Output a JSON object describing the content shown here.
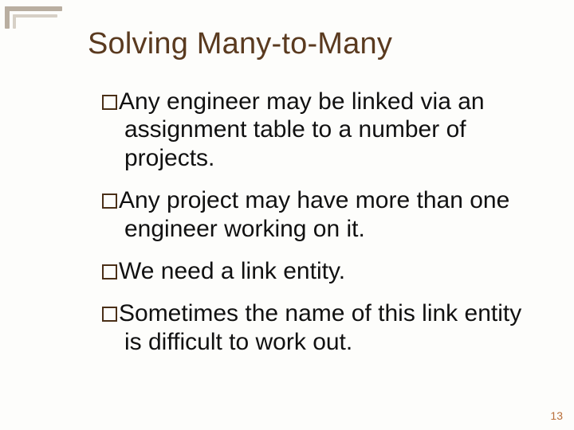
{
  "title": "Solving Many-to-Many",
  "bullets": [
    "Any engineer may be linked via an assignment table to a number of projects.",
    "Any project may have more than one engineer working on it.",
    "We need a link entity.",
    "Sometimes the name of this link entity is difficult to work out."
  ],
  "page_number": "13"
}
